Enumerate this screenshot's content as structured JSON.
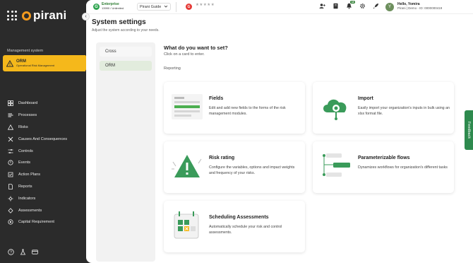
{
  "brand": {
    "name": "pirani"
  },
  "sidebar": {
    "collapse_icon": "‹",
    "section_label": "Management system",
    "active_system": {
      "title": "ORM",
      "subtitle": "Operational Risk Management"
    },
    "items": [
      {
        "label": "Dashboard",
        "icon": "dashboard-icon"
      },
      {
        "label": "Processes",
        "icon": "processes-icon"
      },
      {
        "label": "Risks",
        "icon": "risks-icon"
      },
      {
        "label": "Causes And Consequences",
        "icon": "causes-icon"
      },
      {
        "label": "Controls",
        "icon": "controls-icon"
      },
      {
        "label": "Events",
        "icon": "events-icon"
      },
      {
        "label": "Action Plans",
        "icon": "action-plans-icon"
      },
      {
        "label": "Reports",
        "icon": "reports-icon"
      },
      {
        "label": "Indicators",
        "icon": "indicators-icon"
      },
      {
        "label": "Assessments",
        "icon": "assessments-icon"
      },
      {
        "label": "Capital Requirement",
        "icon": "capital-icon"
      }
    ]
  },
  "topbar": {
    "plan_logo": "G",
    "plan_name": "Enterprise",
    "plan_count": "13990 / Unlimited",
    "guide_label": "Pirani Guide",
    "rating_logo": "G",
    "stars": "★★★★★",
    "user_initial": "Y",
    "user_hello": "Hello, Yomira",
    "user_meta": "Pirani | Demo - ID: 0000000419",
    "notification_count": "18"
  },
  "page": {
    "title": "System settings",
    "subtitle": "Adjust the system according to your needs."
  },
  "tabs": [
    {
      "label": "Cross",
      "active": false
    },
    {
      "label": "ORM",
      "active": true
    }
  ],
  "content": {
    "title": "What do you want to set?",
    "subtitle": "Click on a card to enter.",
    "section": "Reporting",
    "cards": [
      {
        "title": "Fields",
        "description": "Edit and add new fields to the forms of the risk management modules."
      },
      {
        "title": "Import",
        "description": "Easily import your organization's inputs in bulk using an xlsx format file."
      },
      {
        "title": "Risk rating",
        "description": "Configure the variables, options and impact weights and frequency of your risks."
      },
      {
        "title": "Parameterizable flows",
        "description": "Dynamizes workflows for organization's different tasks"
      },
      {
        "title": "Scheduling Assessments",
        "description": "Automatically schedule your risk and control assessments."
      }
    ]
  },
  "feedback": {
    "label": "Feedback"
  },
  "colors": {
    "accent": "#f5b81b",
    "brand_green": "#2e8a4e",
    "sidebar_bg": "#2b2b2b"
  }
}
